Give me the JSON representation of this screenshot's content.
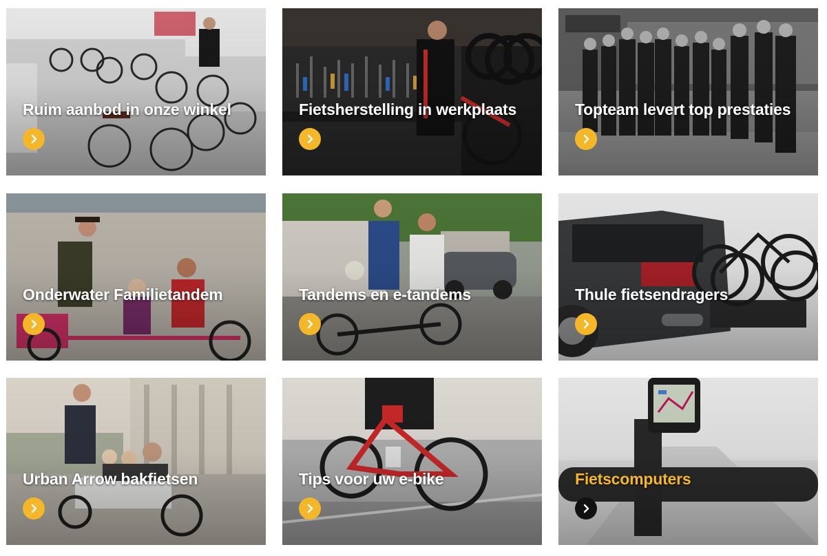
{
  "colors": {
    "accent": "#f5b72a",
    "active_button": "#111111",
    "title_text": "#ffffff"
  },
  "tiles": [
    {
      "title": "Ruim aanbod in onze winkel",
      "icon": "chevron-right-icon"
    },
    {
      "title": "Fietsherstelling in werkplaats",
      "icon": "chevron-right-icon"
    },
    {
      "title": "Topteam levert top prestaties",
      "icon": "chevron-right-icon"
    },
    {
      "title": "Onderwater Familietandem",
      "icon": "chevron-right-icon"
    },
    {
      "title": "Tandems en e-tandems",
      "icon": "chevron-right-icon"
    },
    {
      "title": "Thule fietsendragers",
      "icon": "chevron-right-icon"
    },
    {
      "title": "Urban Arrow bakfietsen",
      "icon": "chevron-right-icon"
    },
    {
      "title": "Tips voor uw e-bike",
      "icon": "chevron-right-icon"
    },
    {
      "title": "Fietscomputers",
      "icon": "chevron-right-icon",
      "state": "hover"
    }
  ]
}
